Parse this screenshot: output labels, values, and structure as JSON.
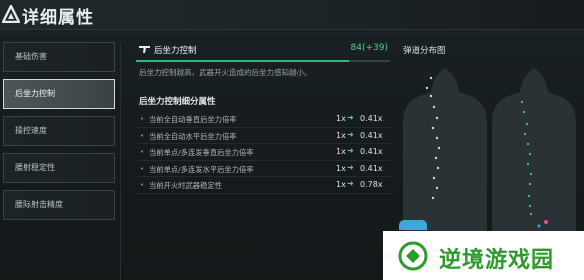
{
  "header": {
    "title": "详细属性"
  },
  "nav": {
    "items": [
      {
        "label": "基础伤害",
        "active": false
      },
      {
        "label": "后坐力控制",
        "active": true
      },
      {
        "label": "操控速度",
        "active": false
      },
      {
        "label": "腰射稳定性",
        "active": false
      },
      {
        "label": "腰际射击精度",
        "active": false
      }
    ]
  },
  "stat": {
    "name": "后坐力控制",
    "value": "84(+39)",
    "progress": 0.84,
    "description": "后坐力控制越高，武器开火造成的后坐力感知越小。"
  },
  "sub": {
    "title": "后坐力控制细分属性",
    "rows": [
      {
        "label": "当前全自动垂直后坐力倍率",
        "from": "1x",
        "to": "0.41x"
      },
      {
        "label": "当前全自动水平后坐力倍率",
        "from": "1x",
        "to": "0.41x"
      },
      {
        "label": "当前单点/多连发垂直后坐力倍率",
        "from": "1x",
        "to": "0.41x"
      },
      {
        "label": "当前单点/多连发水平后坐力倍率",
        "from": "1x",
        "to": "0.41x"
      },
      {
        "label": "当前开火时武器稳定性",
        "from": "1x",
        "to": "0.78x"
      }
    ]
  },
  "spread": {
    "title": "弹道分布图"
  },
  "watermark": {
    "text": "逆境游戏园"
  },
  "colors": {
    "accent": "#4fd48a",
    "bar_fill": "#2fb978",
    "watermark_green": "#2f9a2c"
  }
}
